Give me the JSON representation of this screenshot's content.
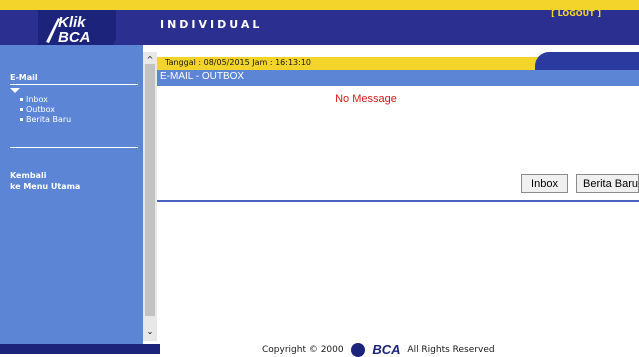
{
  "header": {
    "title": "INDIVIDUAL",
    "logout_label": "[ LOGOUT ]"
  },
  "logo": {
    "line1": "Klik",
    "line2": "BCA"
  },
  "sidebar": {
    "section_heading": "E-Mail",
    "items": [
      {
        "label": "Inbox"
      },
      {
        "label": "Outbox"
      },
      {
        "label": "Berita Baru"
      }
    ],
    "back_link_line1": "Kembali",
    "back_link_line2": "ke Menu Utama"
  },
  "main": {
    "date_text": "Tanggal : 08/05/2015 Jam : 16:13:10",
    "page_title": "E-MAIL - OUTBOX",
    "empty_message": "No Message",
    "buttons": {
      "inbox": "Inbox",
      "berita_baru": "Berita Baru"
    }
  },
  "footer": {
    "copyright_prefix": "Copyright © 2000",
    "brand": "BCA",
    "rights": "All Rights Reserved"
  },
  "colors": {
    "yellow": "#f2d42a",
    "navy": "#2b2f8f",
    "sidebar_blue": "#5c85d6",
    "message_red": "#d61a1a"
  },
  "icons": {
    "scroll_up": "scroll-up-arrow-icon",
    "scroll_down": "scroll-down-arrow-icon",
    "menu_expanded": "triangle-down-icon"
  }
}
